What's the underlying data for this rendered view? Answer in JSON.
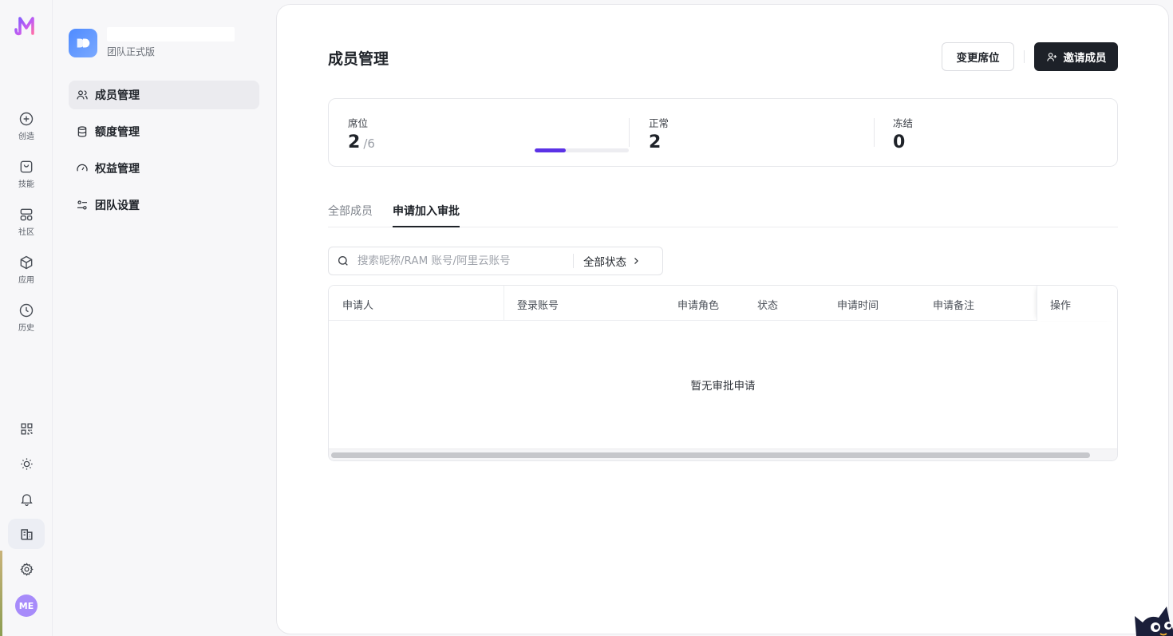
{
  "rail": {
    "items": [
      {
        "label": "创造",
        "icon": "plus-circle-icon"
      },
      {
        "label": "技能",
        "icon": "bag-icon"
      },
      {
        "label": "社区",
        "icon": "grid-icon"
      },
      {
        "label": "应用",
        "icon": "cube-icon"
      },
      {
        "label": "历史",
        "icon": "clock-icon"
      }
    ],
    "avatar_initials": "ME"
  },
  "team": {
    "plan": "团队正式版"
  },
  "nav": [
    {
      "label": "成员管理",
      "active": true
    },
    {
      "label": "额度管理",
      "active": false
    },
    {
      "label": "权益管理",
      "active": false
    },
    {
      "label": "团队设置",
      "active": false
    }
  ],
  "main": {
    "title": "成员管理",
    "change_seats_label": "变更席位",
    "invite_label": "邀请成员",
    "stats": {
      "seats": {
        "label": "席位",
        "value": "2",
        "total": "/6",
        "fraction": 0.3333
      },
      "normal": {
        "label": "正常",
        "value": "2"
      },
      "frozen": {
        "label": "冻结",
        "value": "0"
      }
    },
    "tabs": [
      {
        "label": "全部成员",
        "active": false
      },
      {
        "label": "申请加入审批",
        "active": true
      }
    ],
    "search": {
      "placeholder": "搜索昵称/RAM 账号/阿里云账号",
      "value": ""
    },
    "status_filter": "全部状态",
    "table": {
      "columns": [
        "申请人",
        "登录账号",
        "申请角色",
        "状态",
        "申请时间",
        "申请备注",
        "操作"
      ],
      "empty_text": "暂无审批申请"
    }
  },
  "colors": {
    "accent": "#5b32e6",
    "primary_button": "#1d2128",
    "avatar": "#a78bfa",
    "team_logo": "#4f8bff"
  }
}
